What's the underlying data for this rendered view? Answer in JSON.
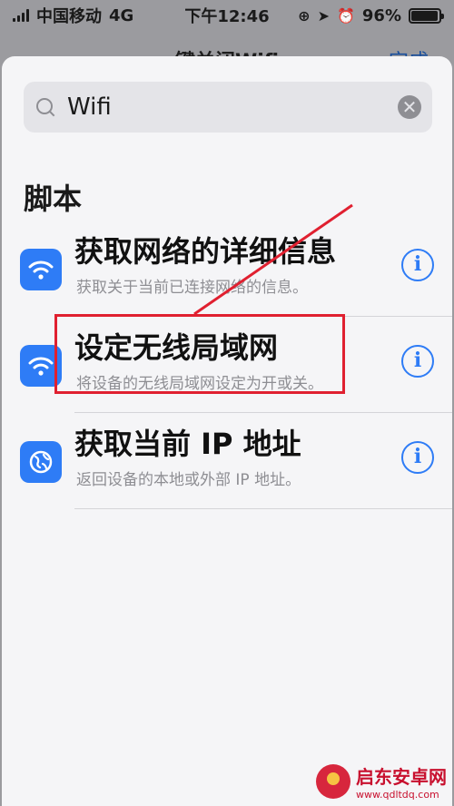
{
  "status_bar": {
    "carrier": "中国移动",
    "network": "4G",
    "time": "下午12:46",
    "battery": "96%",
    "battery_level": 0.96
  },
  "background": {
    "title": "键关闭Wifi",
    "done_label": "完成"
  },
  "search": {
    "value": "Wifi",
    "clear_symbol": "✕"
  },
  "section": {
    "title": "脚本"
  },
  "items": [
    {
      "title": "获取网络的详细信息",
      "subtitle": "获取关于当前已连接网络的信息。",
      "icon": "wifi-icon"
    },
    {
      "title": "设定无线局域网",
      "subtitle": "将设备的无线局域网设定为开或关。",
      "icon": "wifi-icon"
    },
    {
      "title": "获取当前 IP 地址",
      "subtitle": "返回设备的本地或外部 IP 地址。",
      "icon": "globe-icon"
    }
  ],
  "info_symbol": "i",
  "watermark": {
    "name": "启东安卓网",
    "url": "www.qdltdq.com"
  },
  "colors": {
    "accent": "#2e7cf6",
    "annotation": "#e02030"
  }
}
